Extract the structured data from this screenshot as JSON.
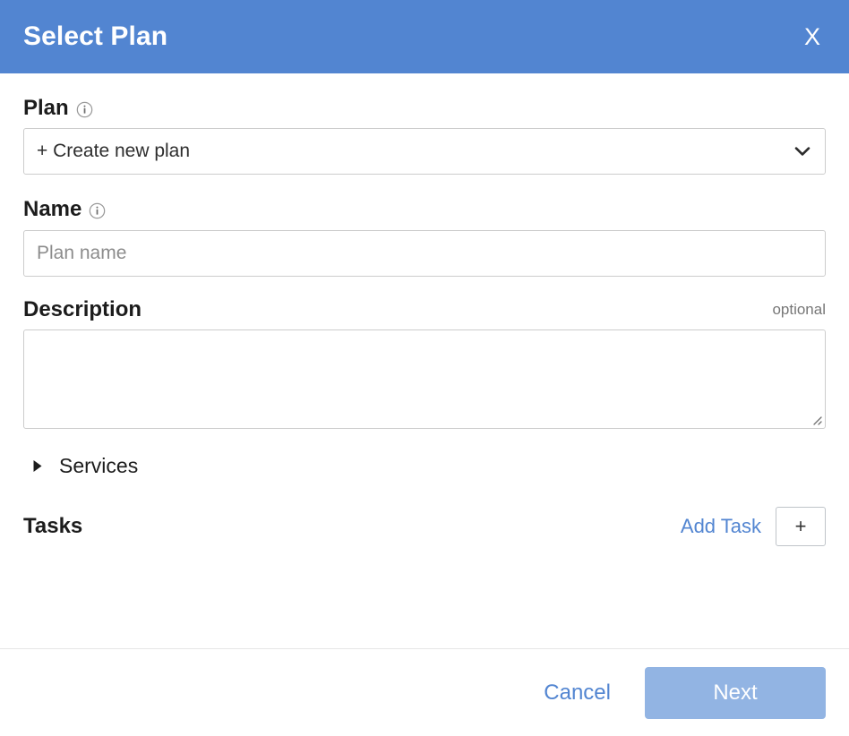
{
  "header": {
    "title": "Select Plan",
    "close_label": "X",
    "background_color": "#5285d1"
  },
  "form": {
    "plan": {
      "label": "Plan",
      "info_icon": "info-circle-icon",
      "selected_option": "+ Create new plan",
      "dropdown_icon": "chevron-down-icon"
    },
    "name": {
      "label": "Name",
      "info_icon": "info-circle-icon",
      "value": "",
      "placeholder": "Plan name"
    },
    "description": {
      "label": "Description",
      "optional_tag": "optional",
      "value": "",
      "placeholder": "",
      "resize_icon": "resize-grip-icon"
    },
    "services": {
      "label": "Services",
      "expanded": false,
      "disclosure_icon": "triangle-right-icon"
    },
    "tasks": {
      "label": "Tasks",
      "add_task_label": "Add Task",
      "add_button_label": "+",
      "add_button_icon": "plus-icon"
    }
  },
  "footer": {
    "cancel_label": "Cancel",
    "next_label": "Next",
    "next_color": "#92b4e3",
    "link_color": "#5285d1"
  }
}
